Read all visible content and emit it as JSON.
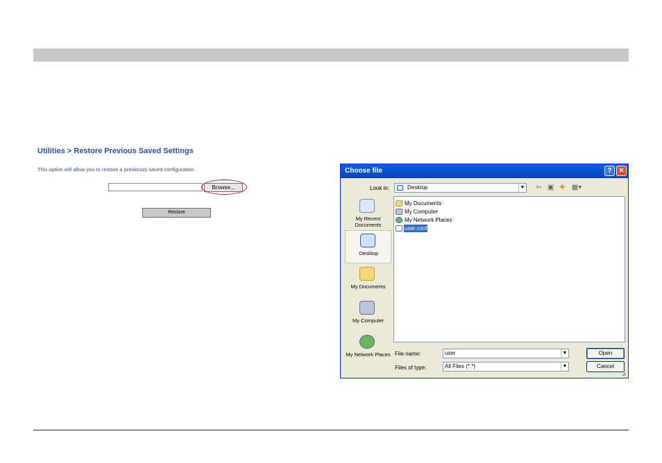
{
  "web_page": {
    "title": "Utilities > Restore Previous Saved Settings",
    "description": "This option will allow you to restore a previously saved configuration.",
    "browse_label": "Browse...",
    "restore_label": "Restore"
  },
  "dialog": {
    "title": "Choose file",
    "help_label": "?",
    "close_label": "✕",
    "look_in_label": "Look in:",
    "look_in_value": "Desktop",
    "places": [
      {
        "label": "My Recent Documents",
        "icon": "recent-documents-icon"
      },
      {
        "label": "Desktop",
        "icon": "desktop-icon"
      },
      {
        "label": "My Documents",
        "icon": "my-documents-icon"
      },
      {
        "label": "My Computer",
        "icon": "my-computer-icon"
      },
      {
        "label": "My Network Places",
        "icon": "network-places-icon"
      }
    ],
    "files": [
      {
        "label": "My Documents",
        "icon": "folder-icon"
      },
      {
        "label": "My Computer",
        "icon": "computer-icon"
      },
      {
        "label": "My Network Places",
        "icon": "network-icon"
      },
      {
        "label": "user.conf",
        "icon": "file-icon"
      }
    ],
    "file_name_label": "File name:",
    "file_name_value": "user",
    "files_of_type_label": "Files of type:",
    "files_of_type_value": "All Files (*.*)",
    "open_label": "Open",
    "cancel_label": "Cancel",
    "colors": {
      "titlebar": "#0a5fdf",
      "selection": "#316ac5",
      "web_text": "#2b4f9e",
      "highlight_circle": "#c0202a"
    }
  }
}
